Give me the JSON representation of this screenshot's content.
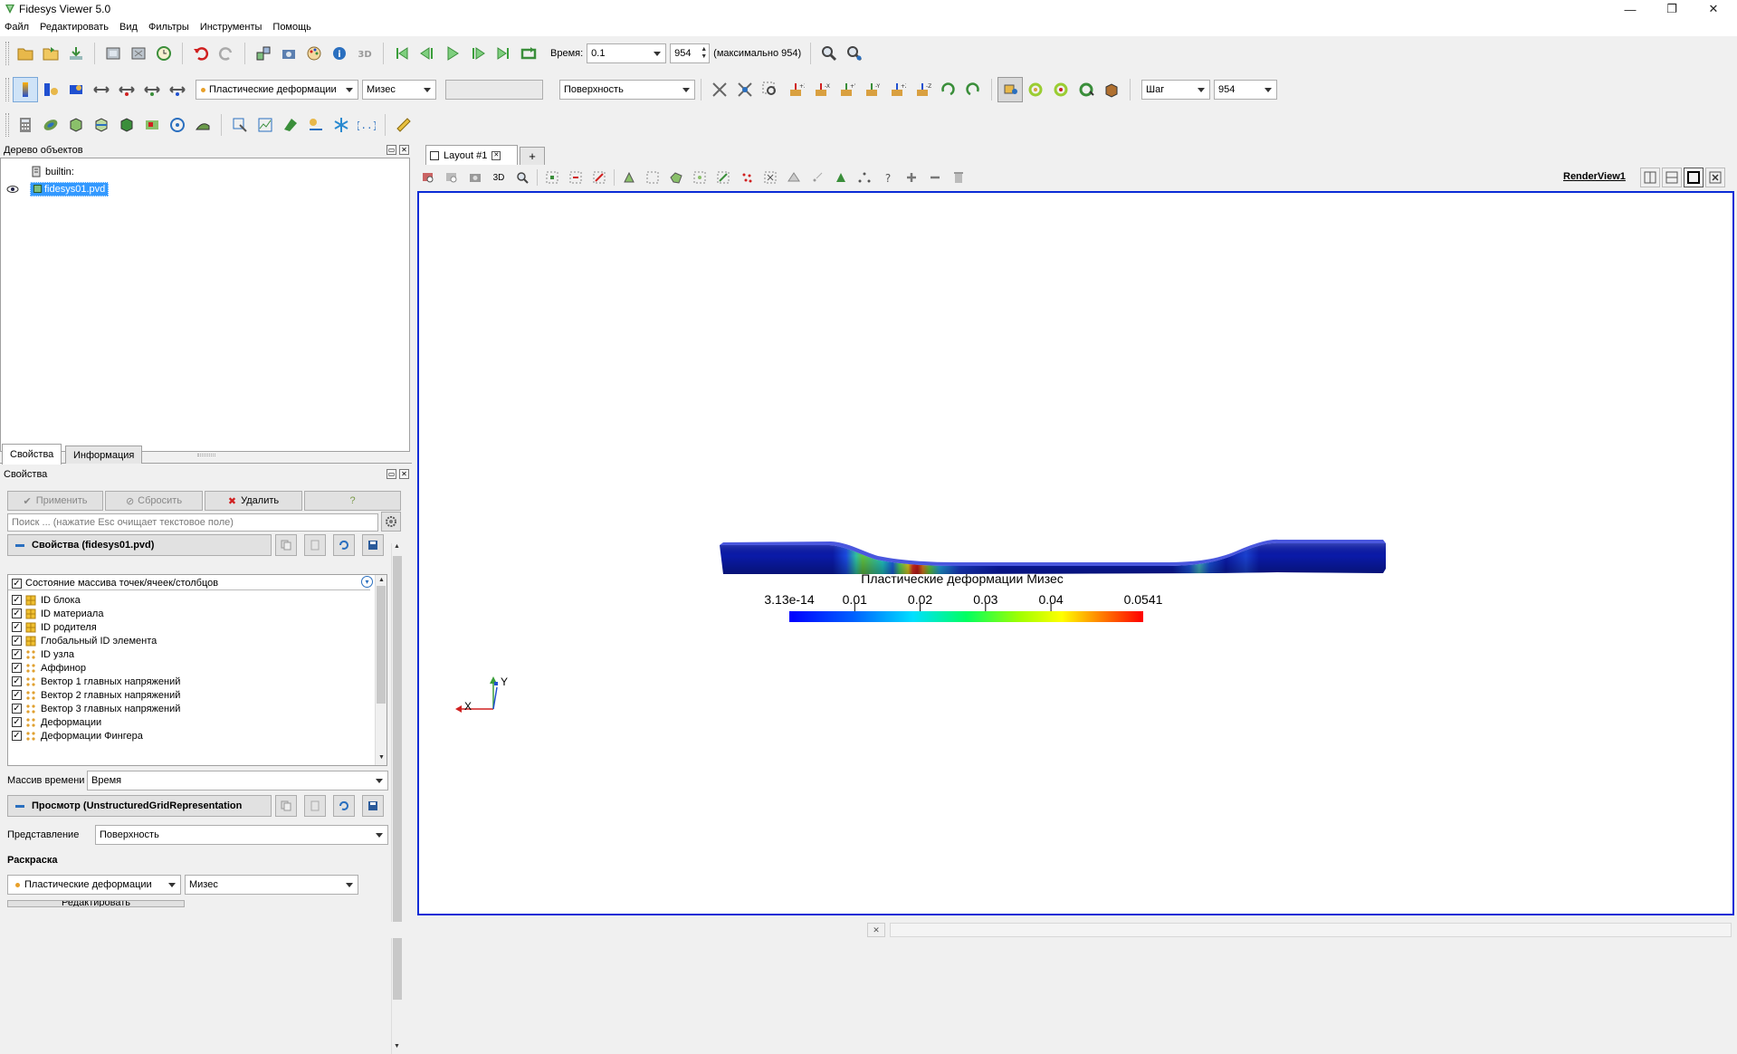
{
  "window": {
    "title": "Fidesys Viewer 5.0",
    "minimize": "—",
    "restore": "❐",
    "close": "✕"
  },
  "menu": [
    "Файл",
    "Редактировать",
    "Вид",
    "Фильтры",
    "Инструменты",
    "Помощь"
  ],
  "toolbar1": {
    "time_label": "Время:",
    "time_value": "0.1",
    "step_value": "954",
    "max_label": "(максимально 954)"
  },
  "toolbar2": {
    "color_by": "Пластические деформации",
    "component": "Мизес",
    "representation": "Поверхность",
    "step_mode": "Шаг",
    "step_value": "954"
  },
  "pipeline": {
    "title": "Дерево объектов",
    "items": [
      {
        "label": "builtin:"
      },
      {
        "label": "fidesys01.pvd"
      }
    ]
  },
  "tabs": [
    "Свойства",
    "Информация"
  ],
  "properties": {
    "title": "Свойства",
    "apply": "Применить",
    "reset": "Сбросить",
    "delete": "Удалить",
    "help": "?",
    "search_placeholder": "Поиск ... (нажатие Esc очищает текстовое поле)",
    "section_props": "Свойства (fidesys01.pvd)",
    "arrays_header": "Состояние массива точек/ячеек/столбцов",
    "arrays": [
      {
        "label": "ID блока",
        "kind": "cell"
      },
      {
        "label": "ID материала",
        "kind": "cell"
      },
      {
        "label": "ID родителя",
        "kind": "cell"
      },
      {
        "label": "Глобальный ID элемента",
        "kind": "cell"
      },
      {
        "label": "ID узла",
        "kind": "point"
      },
      {
        "label": "Аффинор",
        "kind": "point"
      },
      {
        "label": "Вектор 1 главных напряжений",
        "kind": "point"
      },
      {
        "label": "Вектор 2 главных напряжений",
        "kind": "point"
      },
      {
        "label": "Вектор 3 главных напряжений",
        "kind": "point"
      },
      {
        "label": "Деформации",
        "kind": "point"
      },
      {
        "label": "Деформации Фингера",
        "kind": "point"
      }
    ],
    "time_array_label": "Массив времени",
    "time_array_value": "Время",
    "section_view": "Просмотр (UnstructuredGridRepresentation",
    "representation_label": "Представление",
    "representation_value": "Поверхность",
    "coloring_label": "Раскраска",
    "coloring_array": "Пластические деформации",
    "coloring_component": "Мизес",
    "edit_label": "Редактировать"
  },
  "layout": {
    "tab_label": "Layout #1",
    "add_label": "+",
    "view_name": "RenderView1",
    "mode_3d": "3D"
  },
  "colorbar": {
    "title": "Пластические деформации Мизес",
    "min_label": "3.13e-14",
    "tick_labels": [
      "0.01",
      "0.02",
      "0.03",
      "0.04"
    ],
    "max_label": "0.0541",
    "min": 3.13e-14,
    "max": 0.0541,
    "ticks": [
      0.01,
      0.02,
      0.03,
      0.04
    ]
  },
  "axes": {
    "x": "X",
    "y": "Y"
  },
  "colors": {
    "view_border": "#0a2cd6",
    "selection": "#3399ff",
    "colormap": [
      "#0000ff",
      "#00a0ff",
      "#00ffc0",
      "#40ff00",
      "#ffff00",
      "#ff8000",
      "#ff0000"
    ]
  }
}
